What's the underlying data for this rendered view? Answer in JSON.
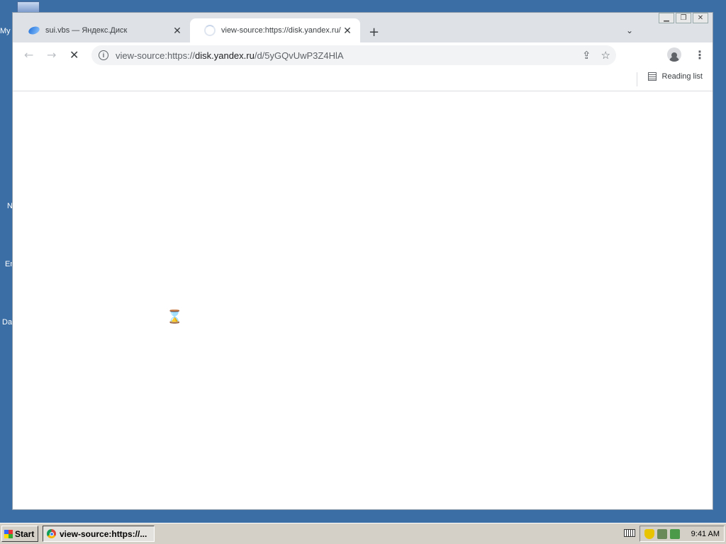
{
  "desktop": {
    "edge_labels": [
      "My",
      "N",
      "En",
      "Da"
    ]
  },
  "window": {
    "controls": [
      "minimize",
      "restore",
      "close"
    ]
  },
  "tabs": [
    {
      "title": "sui.vbs — Яндекс.Диск",
      "icon": "yandex-disk-icon",
      "active": false
    },
    {
      "title": "view-source:https://disk.yandex.ru/",
      "icon": "loading-spinner-icon",
      "active": true
    }
  ],
  "toolbar": {
    "url_scheme": "view-source:https://",
    "url_host": "disk.yandex.ru",
    "url_path": "/d/5yGQvUwP3Z4HlA"
  },
  "bookmarks": {
    "reading_list_label": "Reading list"
  },
  "taskbar": {
    "start_label": "Start",
    "task_label": "view-source:https://...",
    "clock": "9:41 AM"
  },
  "colors": {
    "desktop": "#3a6ea5",
    "taskbar": "#d4d0c8",
    "tab_strip": "#dee1e6"
  }
}
